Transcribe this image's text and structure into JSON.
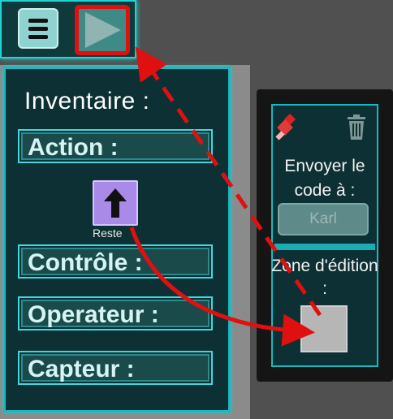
{
  "toolbar": {
    "menu_icon": "hamburger-icon",
    "play_icon": "play-icon"
  },
  "inventory": {
    "title": "Inventaire :",
    "categories": [
      "Action :",
      "Contrôle :",
      "Operateur :",
      "Capteur :"
    ],
    "block": {
      "icon": "up-arrow-icon",
      "label": "Reste"
    }
  },
  "right_panel": {
    "brush_icon": "paint-brush-icon",
    "trash_icon": "trash-icon",
    "send_label": "Envoyer le code à :",
    "recipient_value": "Karl",
    "zone_label": "Zone d'édition :"
  },
  "colors": {
    "accent": "#1fd3d6",
    "panel": "#0c3033",
    "highlight": "#e01010",
    "block": "#a98ae8"
  }
}
